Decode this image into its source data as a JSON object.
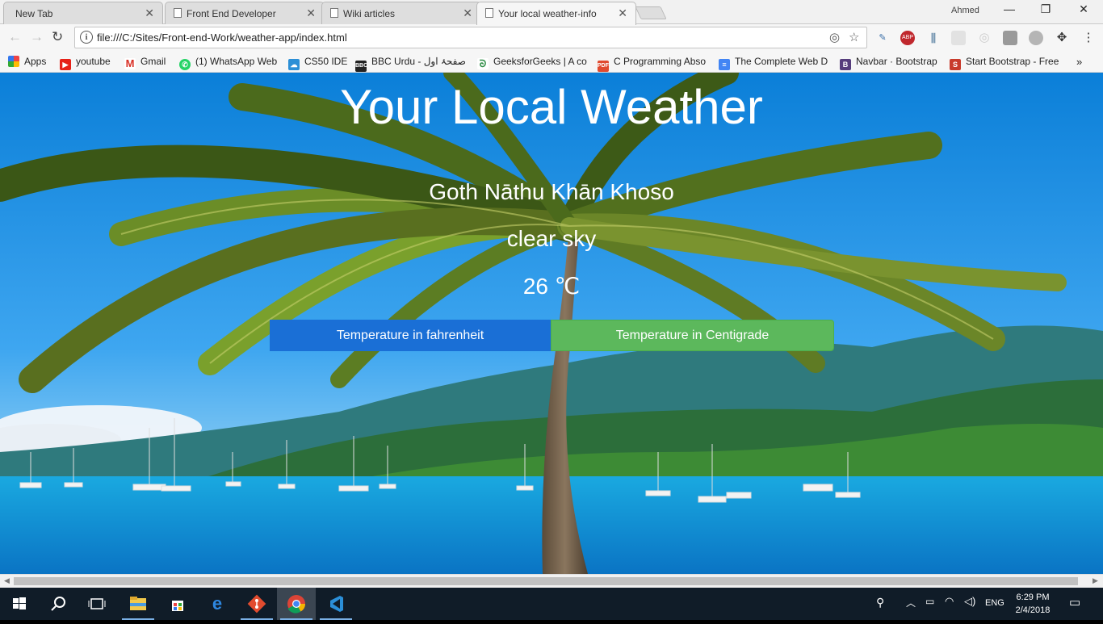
{
  "browser": {
    "tabs": [
      {
        "title": "New Tab",
        "active": false,
        "favicon": "none"
      },
      {
        "title": "Front End Developer",
        "active": false,
        "favicon": "page-icon"
      },
      {
        "title": "Wiki articles",
        "active": false,
        "favicon": "page-icon"
      },
      {
        "title": "Your local weather-info",
        "active": true,
        "favicon": "page-icon"
      }
    ],
    "profile_name": "Ahmed",
    "address": "file:///C:/Sites/Front-end-Work/weather-app/index.html",
    "bookmarks": [
      {
        "label": "Apps",
        "icon": "apps-grid-icon"
      },
      {
        "label": "youtube",
        "icon": "youtube-icon"
      },
      {
        "label": "Gmail",
        "icon": "gmail-icon"
      },
      {
        "label": "(1) WhatsApp Web",
        "icon": "whatsapp-icon"
      },
      {
        "label": "CS50 IDE",
        "icon": "cloud9-icon"
      },
      {
        "label": "BBC Urdu - صفحۂ اول",
        "icon": "bbc-icon"
      },
      {
        "label": "GeeksforGeeks | A co",
        "icon": "geeksforgeeks-icon"
      },
      {
        "label": "C Programming Abso",
        "icon": "pdf-icon"
      },
      {
        "label": "The Complete Web D",
        "icon": "docs-icon"
      },
      {
        "label": "Navbar · Bootstrap",
        "icon": "bootstrap-icon"
      },
      {
        "label": "Start Bootstrap - Free",
        "icon": "startbootstrap-icon"
      }
    ]
  },
  "page": {
    "title": "Your Local Weather",
    "city": "Goth Nāthu Khān Khoso",
    "condition": "clear sky",
    "temperature": "26 ℃",
    "button_fahrenheit": "Temperature in fahrenheit",
    "button_centigrade": "Temperature in Centigrade",
    "background": "tropical palm tree beach scene"
  },
  "taskbar": {
    "language": "ENG",
    "time": "6:29 PM",
    "date": "2/4/2018",
    "pinned": [
      "file-explorer-icon",
      "store-icon",
      "edge-icon",
      "git-icon",
      "chrome-icon",
      "vscode-icon"
    ]
  },
  "colors": {
    "fahrenheit_button": "#1a6fd6",
    "centigrade_button": "#5cb85c",
    "taskbar": "#101c28"
  }
}
